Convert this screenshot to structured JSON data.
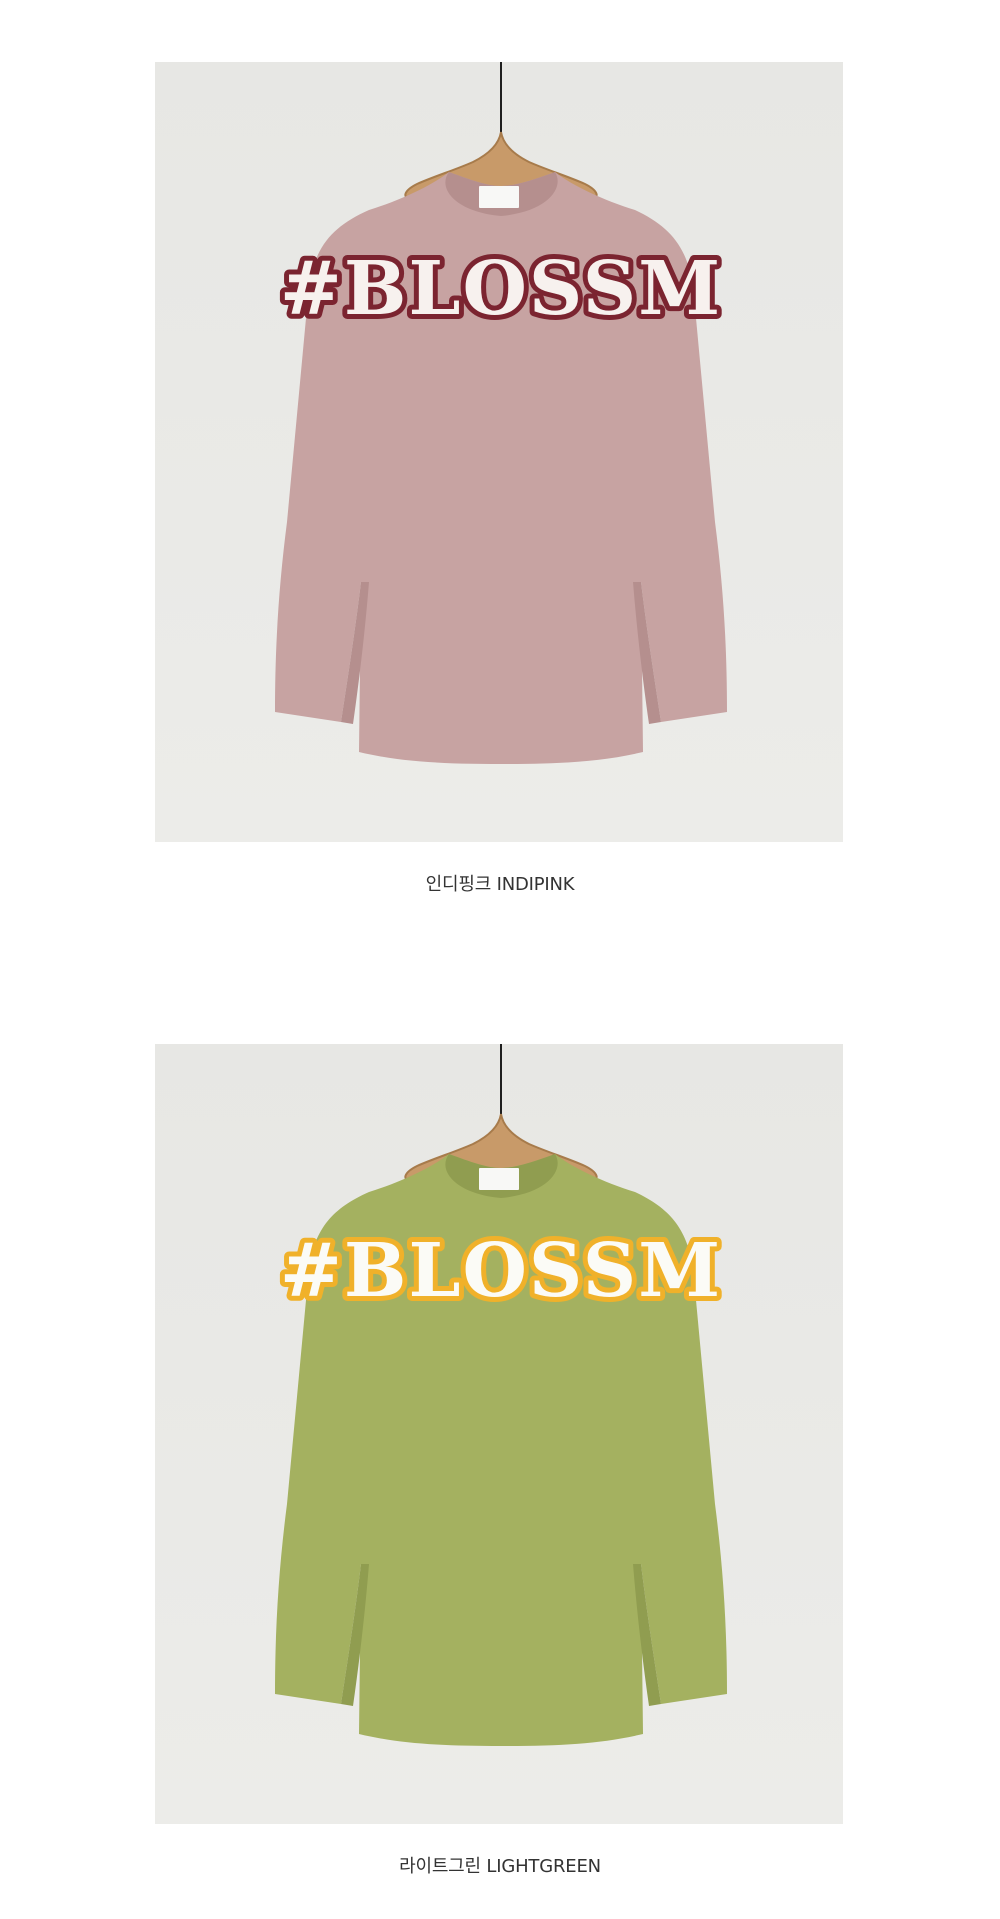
{
  "products": [
    {
      "caption": "인디핑크 INDIPINK",
      "print_text": "#BLOSSM",
      "shirt_color": "#c7a3a2",
      "shirt_shadow": "#b58f8e",
      "print_fill": "#f7f1ee",
      "print_outline": "#7b2430",
      "background_color": "#e9e9e6"
    },
    {
      "caption": "라이트그린 LIGHTGREEN",
      "print_text": "#BLOSSM",
      "shirt_color": "#a4b160",
      "shirt_shadow": "#909d50",
      "print_fill": "#fbfbf6",
      "print_outline": "#f0b12a",
      "background_color": "#e9e9e6"
    }
  ]
}
